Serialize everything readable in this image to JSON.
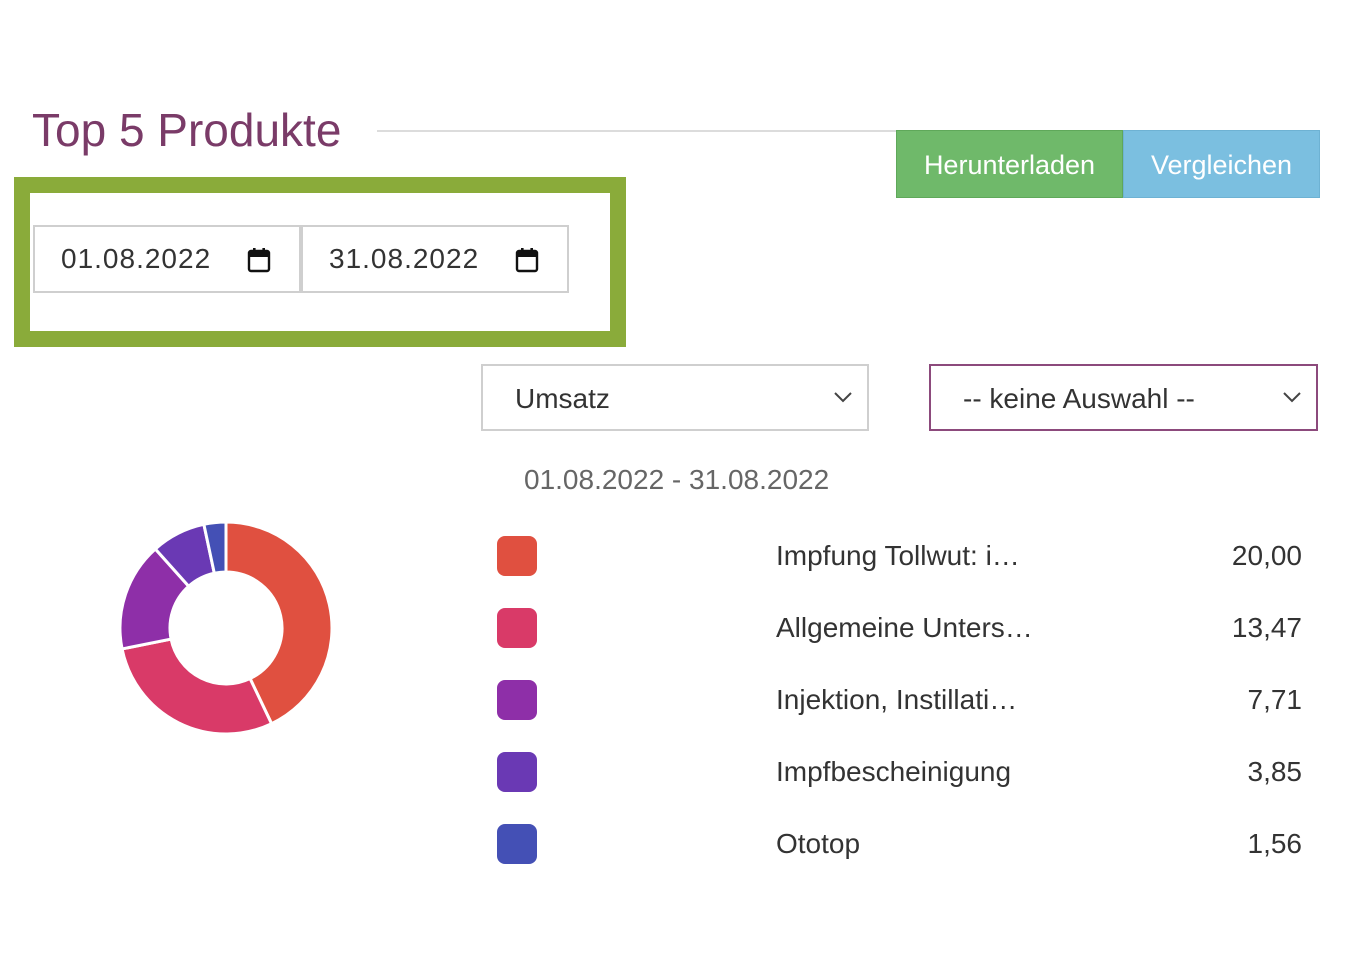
{
  "header": {
    "title": "Top 5 Produkte",
    "download_label": "Herunterladen",
    "compare_label": "Vergleichen",
    "download_color": "#6fb96a",
    "compare_color": "#7bbfe0"
  },
  "filters": {
    "date_from": "01.08.2022",
    "date_to": "31.08.2022",
    "metric_select": "Umsatz",
    "compare_select": "-- keine Auswahl --",
    "highlight_color": "#8aab3a"
  },
  "icons": {
    "date_from_icon": "calendar-icon",
    "date_to_icon": "calendar-icon",
    "select_icon": "chevron-down-icon"
  },
  "chart_range_label": "01.08.2022 - 31.08.2022",
  "chart_data": {
    "type": "pie",
    "variant": "donut",
    "categories": [
      "Impfung Tollwut: i…",
      "Allgemeine Unters…",
      "Injektion, Instillati…",
      "Impfbescheinigung",
      "Ototop"
    ],
    "values": [
      20.0,
      13.47,
      7.71,
      3.85,
      1.56
    ],
    "display_values": [
      "20,00",
      "13,47",
      "7,71",
      "3,85",
      "1,56"
    ],
    "colors": [
      "#e05040",
      "#d93a68",
      "#8e2fa8",
      "#6a39b4",
      "#4450b5"
    ],
    "title": "",
    "legend_position": "right"
  }
}
